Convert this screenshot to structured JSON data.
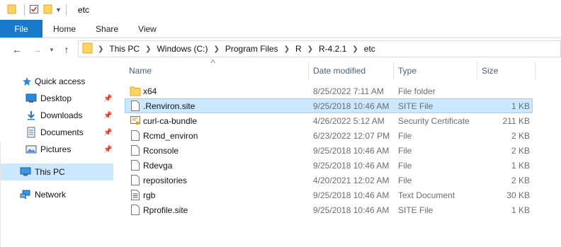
{
  "window": {
    "title": "etc",
    "quick_access_toolbar": [
      "folder-icon",
      "properties-icon",
      "new-folder-icon",
      "customize-dropdown-icon"
    ]
  },
  "ribbon": {
    "tabs": [
      {
        "label": "File",
        "active": true
      },
      {
        "label": "Home"
      },
      {
        "label": "Share"
      },
      {
        "label": "View"
      }
    ]
  },
  "navigation": {
    "back_icon": "arrow-left-icon",
    "forward_icon": "arrow-right-icon",
    "recent_icon": "chevron-down-icon",
    "up_icon": "arrow-up-icon",
    "breadcrumb": [
      "This PC",
      "Windows (C:)",
      "Program Files",
      "R",
      "R-4.2.1",
      "etc"
    ]
  },
  "nav_pane": {
    "items": [
      {
        "label": "Quick access",
        "icon": "star-icon"
      },
      {
        "label": "Desktop",
        "icon": "desktop-icon",
        "pinned": true
      },
      {
        "label": "Downloads",
        "icon": "download-icon",
        "pinned": true
      },
      {
        "label": "Documents",
        "icon": "documents-icon",
        "pinned": true
      },
      {
        "label": "Pictures",
        "icon": "pictures-icon",
        "pinned": true
      },
      {
        "label": "This PC",
        "icon": "computer-icon",
        "selected": true
      },
      {
        "label": "Network",
        "icon": "network-icon"
      }
    ]
  },
  "file_list": {
    "columns": [
      "Name",
      "Date modified",
      "Type",
      "Size"
    ],
    "sort_column": "Name",
    "rows": [
      {
        "name": "x64",
        "date": "8/25/2022 7:11 AM",
        "type": "File folder",
        "size": "",
        "icon": "folder-icon"
      },
      {
        "name": ".Renviron.site",
        "date": "9/25/2018 10:46 AM",
        "type": "SITE File",
        "size": "1 KB",
        "icon": "file-icon",
        "selected": true
      },
      {
        "name": "curl-ca-bundle",
        "date": "4/26/2022 5:12 AM",
        "type": "Security Certificate",
        "size": "211 KB",
        "icon": "certificate-icon"
      },
      {
        "name": "Rcmd_environ",
        "date": "6/23/2022 12:07 PM",
        "type": "File",
        "size": "2 KB",
        "icon": "file-icon"
      },
      {
        "name": "Rconsole",
        "date": "9/25/2018 10:46 AM",
        "type": "File",
        "size": "2 KB",
        "icon": "file-icon"
      },
      {
        "name": "Rdevga",
        "date": "9/25/2018 10:46 AM",
        "type": "File",
        "size": "1 KB",
        "icon": "file-icon"
      },
      {
        "name": "repositories",
        "date": "4/20/2021 12:02 AM",
        "type": "File",
        "size": "2 KB",
        "icon": "file-icon"
      },
      {
        "name": "rgb",
        "date": "9/25/2018 10:46 AM",
        "type": "Text Document",
        "size": "30 KB",
        "icon": "text-document-icon"
      },
      {
        "name": "Rprofile.site",
        "date": "9/25/2018 10:46 AM",
        "type": "SITE File",
        "size": "1 KB",
        "icon": "file-icon"
      }
    ]
  },
  "colors": {
    "accent": "#1979ca",
    "selection": "#cce8ff",
    "selection_border": "#99d1ff",
    "folder": "#ffd45c",
    "header_text": "#4c607a"
  }
}
